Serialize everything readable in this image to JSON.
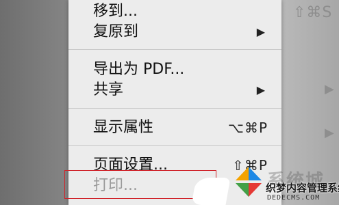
{
  "background": {
    "ghost_shortcut": "⇧⌘S",
    "ghost_arrow": "▶"
  },
  "menu": {
    "items": [
      {
        "label": "移到...",
        "shortcut": "",
        "submenu": false
      },
      {
        "label": "复原到",
        "shortcut": "",
        "submenu": true,
        "arrow": "▶"
      },
      {
        "label": "导出为 PDF...",
        "shortcut": "",
        "submenu": false
      },
      {
        "label": "共享",
        "shortcut": "",
        "submenu": true,
        "arrow": "▶"
      },
      {
        "label": "显示属性",
        "shortcut": "⌥⌘P",
        "submenu": false
      },
      {
        "label": "页面设置...",
        "shortcut": "⇧⌘P",
        "submenu": false
      },
      {
        "label": "打印...",
        "shortcut": "",
        "submenu": false,
        "state": "disabled"
      }
    ]
  },
  "highlight_color": "#d0232a",
  "watermark": {
    "text": "系统城",
    "subtitle": "织梦内容管理系统",
    "url": "DEDECMS.COM",
    "colors": [
      "#1e88e5",
      "#f4a300",
      "#43a047",
      "#e53935"
    ]
  }
}
